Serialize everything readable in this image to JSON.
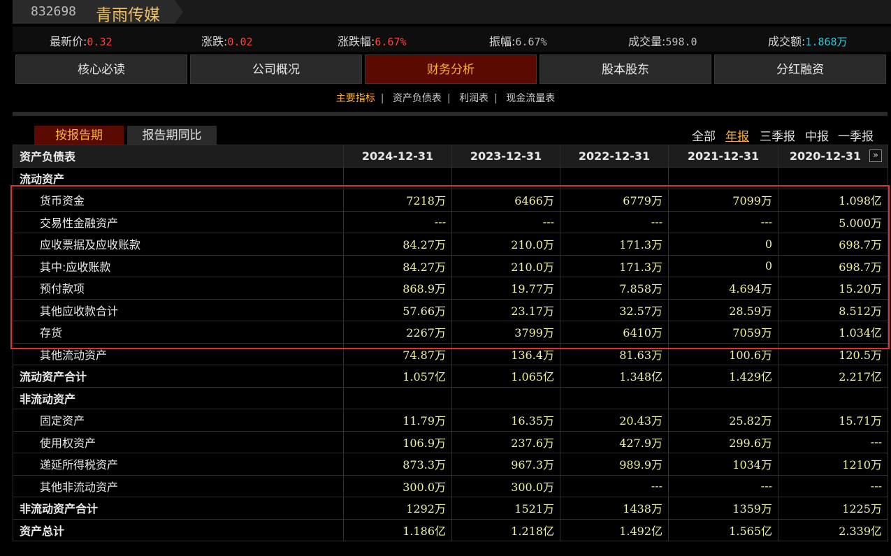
{
  "header": {
    "code": "832698",
    "name": "青雨传媒"
  },
  "quote": [
    {
      "label": "最新价:",
      "value": "0.32",
      "color": "red"
    },
    {
      "label": "涨跌:",
      "value": "0.02",
      "color": "red"
    },
    {
      "label": "涨跌幅:",
      "value": "6.67%",
      "color": "red"
    },
    {
      "label": "振幅:",
      "value": "6.67%",
      "color": "gray"
    },
    {
      "label": "成交量:",
      "value": "598.0",
      "color": "gray"
    },
    {
      "label": "成交额:",
      "value": "1.868万",
      "color": "cyan"
    }
  ],
  "tabs": [
    "核心必读",
    "公司概况",
    "财务分析",
    "股本股东",
    "分红融资"
  ],
  "active_tab": "财务分析",
  "subnav": [
    "主要指标",
    "资产负债表",
    "利润表",
    "现金流量表"
  ],
  "mode_buttons": [
    "按报告期",
    "报告期同比"
  ],
  "periods": [
    "全部",
    "年报",
    "三季报",
    "中报",
    "一季报"
  ],
  "active_period": "年报",
  "table": {
    "title": "资产负债表",
    "dates": [
      "2024-12-31",
      "2023-12-31",
      "2022-12-31",
      "2021-12-31",
      "2020-12-31"
    ],
    "rows": [
      {
        "name": "流动资产",
        "level": 1,
        "values": [
          "",
          "",
          "",
          "",
          ""
        ]
      },
      {
        "name": "货币资金",
        "level": 2,
        "values": [
          "7218万",
          "6466万",
          "6779万",
          "7099万",
          "1.098亿"
        ]
      },
      {
        "name": "交易性金融资产",
        "level": 2,
        "values": [
          "---",
          "---",
          "---",
          "---",
          "5.000万"
        ]
      },
      {
        "name": "应收票据及应收账款",
        "level": 2,
        "values": [
          "84.27万",
          "210.0万",
          "171.3万",
          "0",
          "698.7万"
        ]
      },
      {
        "name": "其中:应收账款",
        "level": 2,
        "values": [
          "84.27万",
          "210.0万",
          "171.3万",
          "0",
          "698.7万"
        ]
      },
      {
        "name": "预付款项",
        "level": 2,
        "values": [
          "868.9万",
          "19.77万",
          "7.858万",
          "4.694万",
          "15.20万"
        ]
      },
      {
        "name": "其他应收款合计",
        "level": 2,
        "values": [
          "57.66万",
          "23.17万",
          "32.57万",
          "28.59万",
          "8.512万"
        ]
      },
      {
        "name": "存货",
        "level": 2,
        "values": [
          "2267万",
          "3799万",
          "6410万",
          "7059万",
          "1.034亿"
        ]
      },
      {
        "name": "其他流动资产",
        "level": 2,
        "values": [
          "74.87万",
          "136.4万",
          "81.63万",
          "100.6万",
          "120.5万"
        ]
      },
      {
        "name": "流动资产合计",
        "level": 1,
        "values": [
          "1.057亿",
          "1.065亿",
          "1.348亿",
          "1.429亿",
          "2.217亿"
        ]
      },
      {
        "name": "非流动资产",
        "level": 1,
        "values": [
          "",
          "",
          "",
          "",
          ""
        ]
      },
      {
        "name": "固定资产",
        "level": 2,
        "values": [
          "11.79万",
          "16.35万",
          "20.43万",
          "25.82万",
          "15.71万"
        ]
      },
      {
        "name": "使用权资产",
        "level": 2,
        "values": [
          "106.9万",
          "237.6万",
          "427.9万",
          "299.6万",
          "---"
        ]
      },
      {
        "name": "递延所得税资产",
        "level": 2,
        "values": [
          "873.3万",
          "967.3万",
          "989.9万",
          "1034万",
          "1210万"
        ]
      },
      {
        "name": "其他非流动资产",
        "level": 2,
        "values": [
          "300.0万",
          "300.0万",
          "---",
          "---",
          "---"
        ]
      },
      {
        "name": "非流动资产合计",
        "level": 1,
        "values": [
          "1292万",
          "1521万",
          "1438万",
          "1359万",
          "1225万"
        ]
      },
      {
        "name": "资产总计",
        "level": 1,
        "values": [
          "1.186亿",
          "1.218亿",
          "1.492亿",
          "1.565亿",
          "2.339亿"
        ]
      }
    ]
  },
  "icons": {
    "next_arrow": "double-chevron-right-icon"
  }
}
